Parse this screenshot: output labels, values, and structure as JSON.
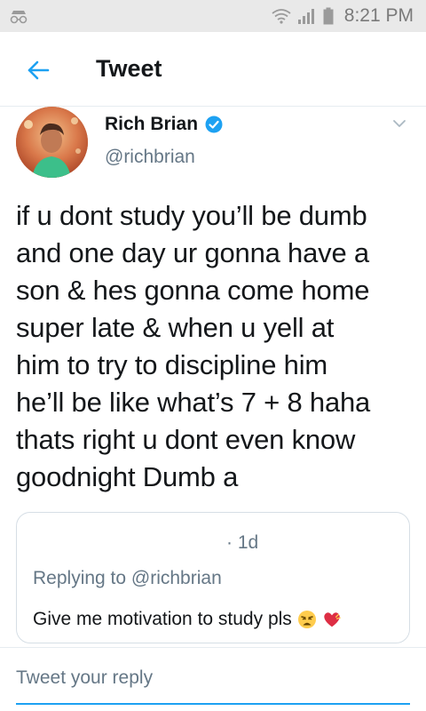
{
  "status_bar": {
    "time": "8:21 PM",
    "left_icon": "notification-icon",
    "right_icons": [
      "wifi-icon",
      "signal-icon",
      "battery-icon"
    ]
  },
  "header": {
    "back_icon": "back-arrow-icon",
    "title": "Tweet"
  },
  "tweet": {
    "author_name": "Rich Brian",
    "author_handle": "@richbrian",
    "verified": true,
    "lines": [
      "if u dont study you’ll be dumb",
      "and one day ur gonna have a",
      "son & hes gonna come home",
      "super late & when u yell at",
      "him to try to discipline him",
      "he’ll be like what’s 7 + 8 haha",
      "thats right u dont even know",
      "goodnight Dumb a"
    ]
  },
  "reply": {
    "time": "· 1d",
    "replying_prefix": "Replying to",
    "replying_handle": "@richbrian",
    "text": "Give me motivation to study pls",
    "emojis": [
      "weary-face-emoji",
      "heart-emoji"
    ]
  },
  "composer": {
    "placeholder": "Tweet your reply"
  },
  "colors": {
    "accent": "#1da1f2",
    "secondary_text": "#657786",
    "status_bar_bg": "#e9e9e9"
  }
}
